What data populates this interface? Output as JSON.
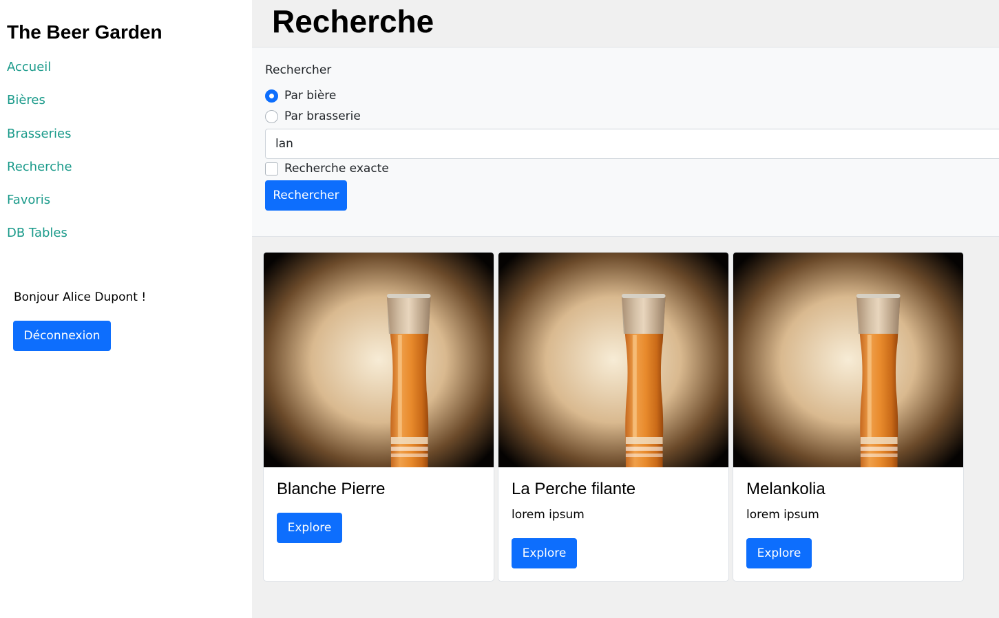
{
  "sidebar": {
    "brand": "The Beer Garden",
    "nav": [
      {
        "label": "Accueil"
      },
      {
        "label": "Bières"
      },
      {
        "label": "Brasseries"
      },
      {
        "label": "Recherche"
      },
      {
        "label": "Favoris"
      },
      {
        "label": "DB Tables"
      }
    ],
    "greeting": "Bonjour Alice Dupont !",
    "logout_label": "Déconnexion"
  },
  "main": {
    "title": "Recherche",
    "search": {
      "label": "Rechercher",
      "options": [
        {
          "label": "Par bière",
          "checked": true
        },
        {
          "label": "Par brasserie",
          "checked": false
        }
      ],
      "query": "lan",
      "exact_label": "Recherche exacte",
      "exact_checked": false,
      "submit_label": "Rechercher"
    },
    "results": [
      {
        "title": "Blanche Pierre",
        "text": "",
        "button": "Explore"
      },
      {
        "title": "La Perche filante",
        "text": "lorem ipsum",
        "button": "Explore"
      },
      {
        "title": "Melankolia",
        "text": "lorem ipsum",
        "button": "Explore"
      }
    ]
  },
  "colors": {
    "accent": "#0d6efd",
    "nav_link": "#1a9a8a",
    "sidebar_bg": "#ffffff",
    "page_bg": "#f0f0f0"
  }
}
